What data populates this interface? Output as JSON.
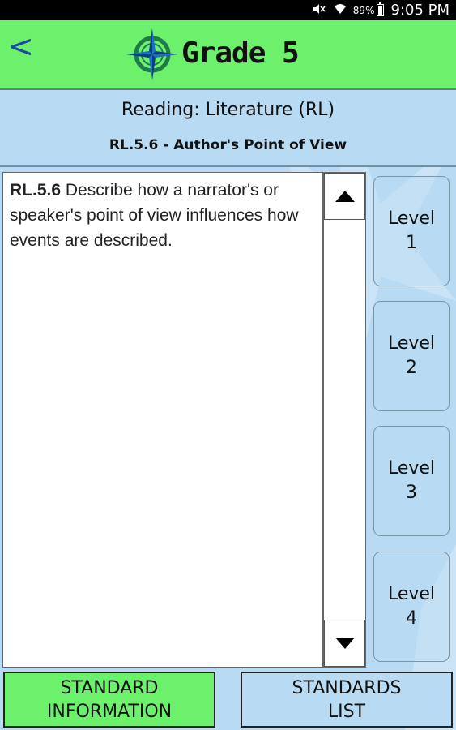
{
  "status_bar": {
    "battery": "89%",
    "time": "9:05 PM",
    "icons": [
      "mute-icon",
      "wifi-icon",
      "battery-icon"
    ]
  },
  "header": {
    "back_label": "<",
    "title": "Grade 5",
    "logo_icon": "compass-icon",
    "background": "#6df06b"
  },
  "subject": "Reading: Literature (RL)",
  "standard_heading": "RL.5.6 - Author's Point of View",
  "content": {
    "code": "RL.5.6",
    "text": " Describe how a narrator's or speaker's point of view influences how events are described."
  },
  "levels": [
    {
      "word": "Level",
      "num": "1"
    },
    {
      "word": "Level",
      "num": "2"
    },
    {
      "word": "Level",
      "num": "3"
    },
    {
      "word": "Level",
      "num": "4"
    }
  ],
  "bottom": {
    "info_line1": "STANDARD",
    "info_line2": "INFORMATION",
    "list_line1": "STANDARDS",
    "list_line2": "LIST"
  },
  "colors": {
    "accent_green": "#6df06b",
    "panel_blue": "#b9daf3",
    "back_blue": "#1a4aa2"
  }
}
